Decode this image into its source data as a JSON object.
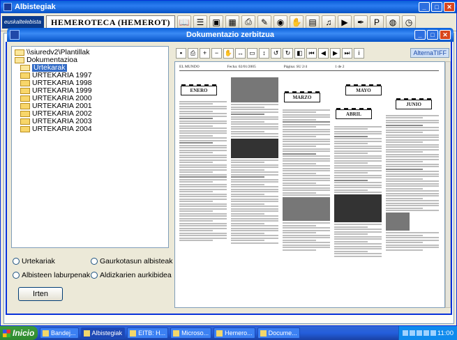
{
  "app": {
    "title": "Albistegiak",
    "brand": "euskaltelebista",
    "hemeroteca": "HEMEROTECA (HEMEROT)"
  },
  "toolbar_icons": [
    "book-icon",
    "list-icon",
    "photo-icon",
    "grid-icon",
    "print-icon",
    "edit-icon",
    "hand-icon",
    "document-icon",
    "music-icon",
    "video-icon",
    "pen-icon",
    "p-icon",
    "globe-icon",
    "clock-icon"
  ],
  "dialog": {
    "title": "Dokumentazio zerbitzua",
    "tree": [
      {
        "label": "\\\\siuredv2\\Plantillak",
        "depth": 0,
        "open": true
      },
      {
        "label": "Dokumentazioa",
        "depth": 0,
        "open": true
      },
      {
        "label": "Urtekarak",
        "depth": 1,
        "selected": true
      },
      {
        "label": "URTEKARIA 1997",
        "depth": 1
      },
      {
        "label": "URTEKARIA 1998",
        "depth": 1
      },
      {
        "label": "URTEKARIA 1999",
        "depth": 1
      },
      {
        "label": "URTEKARIA 2000",
        "depth": 1
      },
      {
        "label": "URTEKARIA 2001",
        "depth": 1
      },
      {
        "label": "URTEKARIA 2002",
        "depth": 1
      },
      {
        "label": "URTEKARIA 2003",
        "depth": 1
      },
      {
        "label": "URTEKARIA 2004",
        "depth": 1
      }
    ],
    "radios": {
      "urtekariak": "Urtekariak",
      "gaurkotasun": "Gaurkotasun albisteak",
      "laburpenak": "Albisteen laburpenak",
      "aldizkarien": "Aldizkarien aurkibidea"
    },
    "exit_label": "Irten",
    "alternatiff": "AlternaTIFF",
    "doc": {
      "paper": "EL MUNDO",
      "date": "Fecha: 02/01/2005",
      "page": "Página: SU 2/4",
      "pages": "1 de 2",
      "months": [
        "ENERO",
        "MARZO",
        "ABRIL",
        "MAYO",
        "JUNIO"
      ]
    }
  },
  "taskbar": {
    "start": "Inicio",
    "tasks": [
      "Bandej...",
      "Albistegiak",
      "EITB: H...",
      "Microso...",
      "Hemero...",
      "Docume..."
    ],
    "clock": "11:00"
  }
}
